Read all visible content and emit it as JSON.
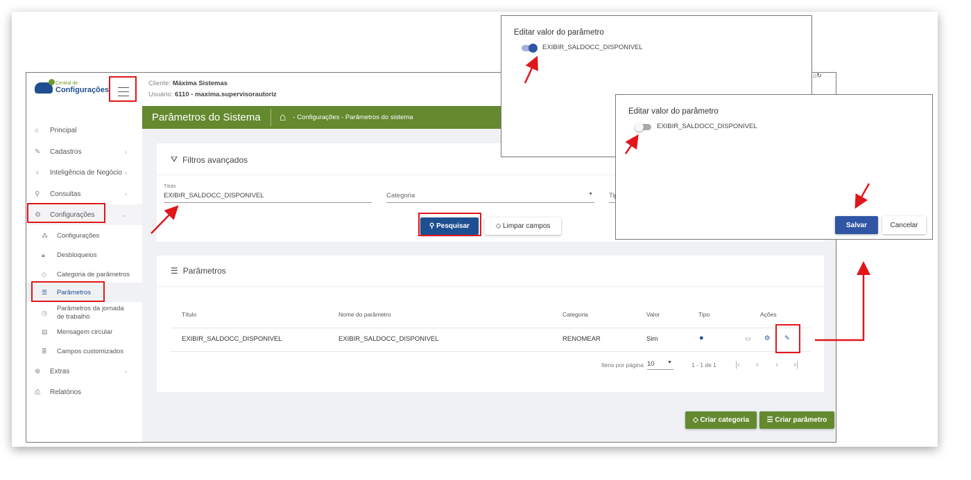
{
  "header": {
    "client_label": "Cliente:",
    "client": "Máxima Sistemas",
    "user_label": "Usuário:",
    "user": "6110 - maxima.supervisorautoriz"
  },
  "logo": {
    "line1": "Central de",
    "line2": "Configurações"
  },
  "sidebar": {
    "items": [
      {
        "label": "Principal",
        "icon": "home-icon"
      },
      {
        "label": "Cadastros",
        "icon": "edit-icon"
      },
      {
        "label": "Inteligência de Negócio",
        "icon": "lightbulb-icon"
      },
      {
        "label": "Consultas",
        "icon": "search-icon"
      },
      {
        "label": "Configurações",
        "icon": "gear-icon"
      },
      {
        "label": "Extras",
        "icon": "plus-circle-icon"
      },
      {
        "label": "Relatórios",
        "icon": "printer-icon"
      }
    ],
    "subitems": [
      {
        "label": "Configurações"
      },
      {
        "label": "Desbloqueios"
      },
      {
        "label": "Categoria de parâmetros"
      },
      {
        "label": "Parâmetros"
      },
      {
        "label": "Parâmetros da jornada de trabalho"
      },
      {
        "label": "Mensagem circular"
      },
      {
        "label": "Campos customizados"
      }
    ]
  },
  "page": {
    "title": "Parâmetros do Sistema",
    "breadcrumb": "- Configurações - Parâmetros do sistema"
  },
  "filters": {
    "title": "Filtros avançados",
    "titulo_label": "Título",
    "titulo_value": "EXIBIR_SALDOCC_DISPONIVEL",
    "categoria_placeholder": "Categoria",
    "tipo_placeholder": "Tipo",
    "search_button": "Pesquisar",
    "clear_button": "Limpar campos"
  },
  "params": {
    "title": "Parâmetros",
    "columns": [
      "Título",
      "Nome do parâmetro",
      "Categoria",
      "Valor",
      "Tipo",
      "Ações"
    ],
    "rows": [
      {
        "titulo": "EXIBIR_SALDOCC_DISPONIVEL",
        "nome": "EXIBIR_SALDOCC_DISPONIVEL",
        "categoria": "RENOMEAR",
        "valor": "Sim"
      }
    ],
    "per_page_label": "Itens por página",
    "per_page": "10",
    "range": "1 - 1 de 1"
  },
  "buttons": {
    "create_category": "Criar categoria",
    "create_param": "Criar parâmetro"
  },
  "dialog1": {
    "title": "Editar valor do parâmetro",
    "toggle_label": "EXIBIR_SALDOCC_DISPONIVEL",
    "toggle_on": true
  },
  "dialog2": {
    "title": "Editar valor do parâmetro",
    "toggle_label": "EXIBIR_SALDOCC_DISPONIVEL",
    "toggle_on": false,
    "save": "Salvar",
    "cancel": "Cancelar"
  },
  "colors": {
    "green": "#64892f",
    "blue": "#2f55a4",
    "red": "#e0161b"
  }
}
